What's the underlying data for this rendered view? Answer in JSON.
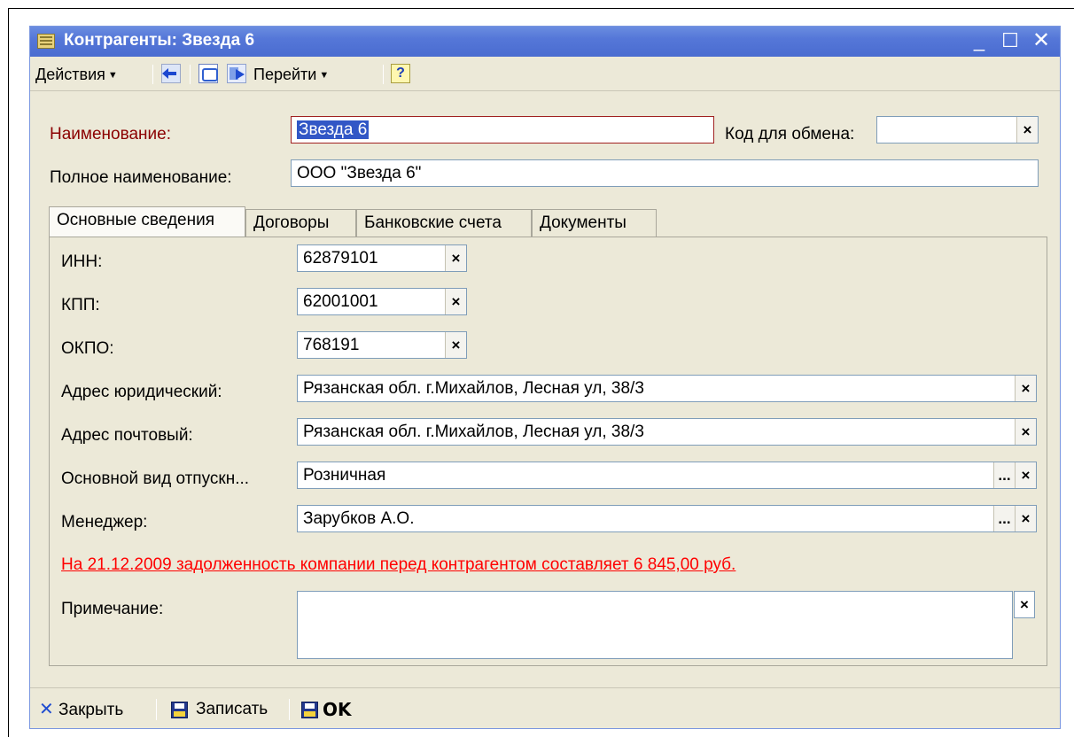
{
  "window": {
    "title": "Контрагенты: Звезда 6",
    "min_glyph": "_",
    "max_glyph": "☐",
    "close_glyph": "✕"
  },
  "toolbar": {
    "actions_label": "Действия",
    "goto_label": "Перейти",
    "help_glyph": "?"
  },
  "header": {
    "name_label": "Наименование:",
    "name_value": "Звезда 6",
    "exchange_code_label": "Код для обмена:",
    "exchange_code_value": "",
    "full_name_label": "Полное наименование:",
    "full_name_value": "ООО \"Звезда 6\""
  },
  "tabs": [
    {
      "label": "Основные сведения",
      "active": true
    },
    {
      "label": "Договоры",
      "active": false
    },
    {
      "label": "Банковские счета",
      "active": false
    },
    {
      "label": "Документы",
      "active": false
    }
  ],
  "main": {
    "inn_label": "ИНН:",
    "inn_value": "62879101",
    "kpp_label": "КПП:",
    "kpp_value": "62001001",
    "okpo_label": "ОКПО:",
    "okpo_value": "768191",
    "legal_address_label": "Адрес юридический:",
    "legal_address_value": "Рязанская обл. г.Михайлов, Лесная ул, 38/3",
    "postal_address_label": "Адрес почтовый:",
    "postal_address_value": "Рязанская обл. г.Михайлов, Лесная ул, 38/3",
    "price_type_label": "Основной вид отпускн...",
    "price_type_value": "Розничная",
    "manager_label": "Менеджер:",
    "manager_value": "Зарубков А.О.",
    "debt_text": "На 21.12.2009 задолженность компании перед контрагентом составляет 6 845,00 руб.",
    "note_label": "Примечание:",
    "note_value": "",
    "clear_glyph": "×",
    "select_glyph": "..."
  },
  "footer": {
    "close_label": "Закрыть",
    "save_label": "Записать",
    "ok_label": "OK"
  },
  "colors": {
    "title_gradient": "#5577d8",
    "window_bg": "#ece9d8",
    "debt_text": "#ff0000",
    "required_label": "#8b0000"
  }
}
